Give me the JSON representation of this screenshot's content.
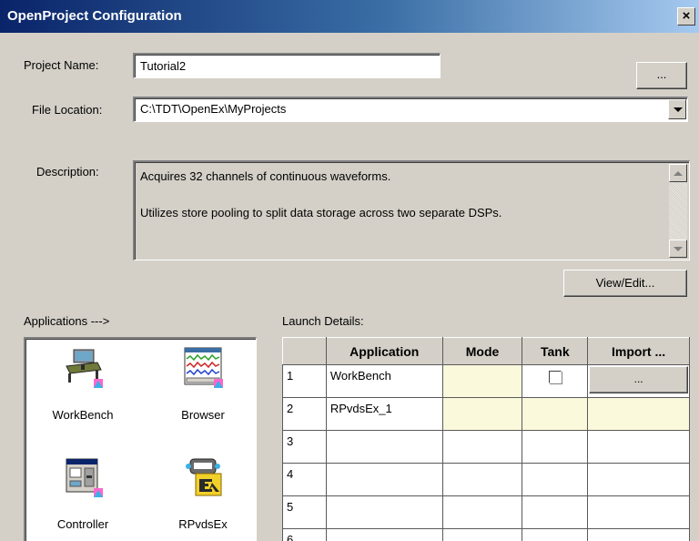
{
  "window": {
    "title": "OpenProject Configuration",
    "close_glyph": "×"
  },
  "project_name": {
    "label": "Project Name:",
    "value": "Tutorial2"
  },
  "browse_button": {
    "label": "..."
  },
  "file_location": {
    "label": "File Location:",
    "value": "C:\\TDT\\OpenEx\\MyProjects"
  },
  "description": {
    "label": "Description:",
    "line1": "Acquires 32 channels of continuous waveforms.",
    "line2": "Utilizes store pooling to split data storage across two separate DSPs."
  },
  "view_edit_button": {
    "label": "View/Edit..."
  },
  "applications": {
    "label": "Applications --->",
    "items": [
      {
        "label": "WorkBench",
        "icon": "workbench-icon"
      },
      {
        "label": "Browser",
        "icon": "browser-icon"
      },
      {
        "label": "Controller",
        "icon": "controller-icon"
      },
      {
        "label": "RPvdsEx",
        "icon": "rpvdsex-icon"
      }
    ]
  },
  "launch_details": {
    "label": "Launch Details:",
    "columns": [
      "Application",
      "Mode",
      "Tank",
      "Import ..."
    ],
    "rows": [
      {
        "num": "1",
        "application": "WorkBench",
        "tank_checkbox": true,
        "import_button": "..."
      },
      {
        "num": "2",
        "application": "RPvdsEx_1"
      },
      {
        "num": "3",
        "application": ""
      },
      {
        "num": "4",
        "application": ""
      },
      {
        "num": "5",
        "application": ""
      },
      {
        "num": "6",
        "application": ""
      }
    ]
  },
  "colors": {
    "title_bar": "#0a246a",
    "dialog_bg": "#d4d0c8",
    "editable_cell": "#fbf9dc"
  }
}
